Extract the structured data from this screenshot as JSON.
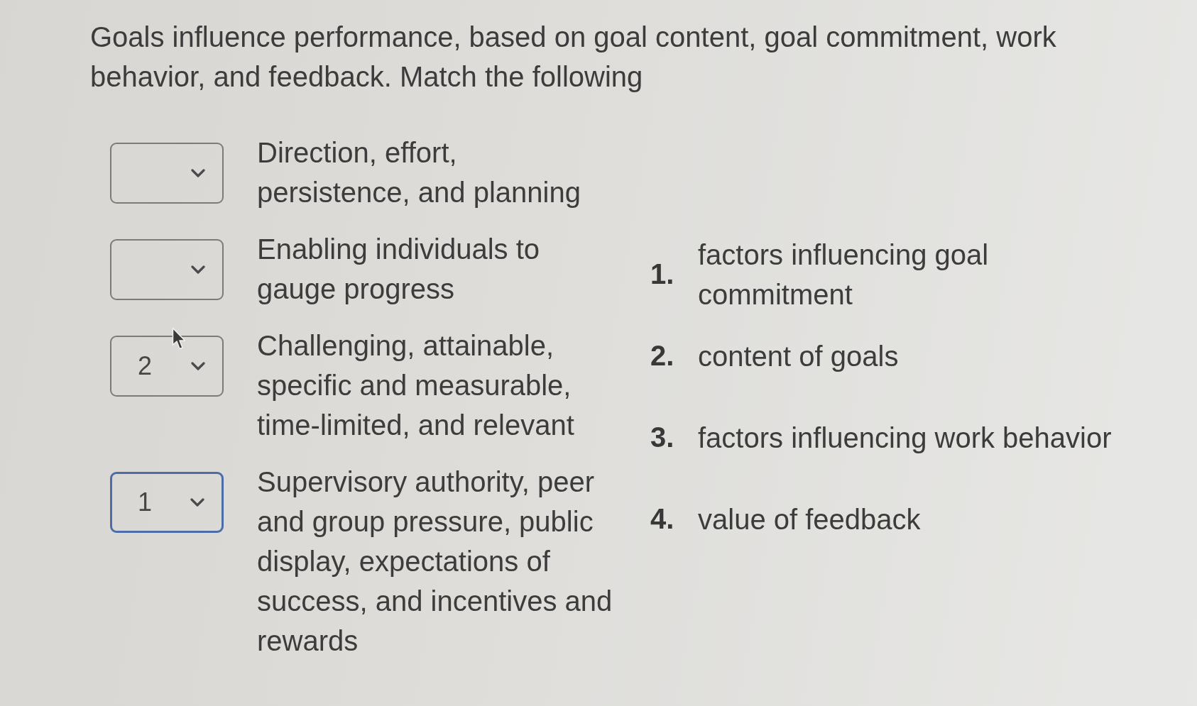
{
  "question": {
    "text": "Goals influence performance, based on goal content, goal commitment, work behavior, and feedback. Match the following"
  },
  "matches": [
    {
      "dropdown": {
        "focused": false
      },
      "prompt": "Direction, effort, persistence, and planning"
    },
    {
      "dropdown": {
        "focused": false
      },
      "prompt": "Enabling individuals to gauge progress"
    },
    {
      "dropdown": {
        "value": "2",
        "focused": false
      },
      "prompt": "Challenging, attainable, specific and measurable, time-limited, and relevant"
    },
    {
      "dropdown": {
        "value": "1",
        "focused": true
      },
      "prompt": "Supervisory authority, peer and group pressure, public display, expectations of success, and incentives and rewards"
    }
  ],
  "options": [
    {
      "number": "1.",
      "text": "factors influencing goal commitment"
    },
    {
      "number": "2.",
      "text": "content of goals"
    },
    {
      "number": "3.",
      "text": "factors influencing work behavior"
    },
    {
      "number": "4.",
      "text": "value of feedback"
    }
  ]
}
